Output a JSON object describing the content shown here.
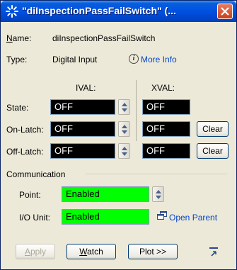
{
  "window": {
    "title": "\"diInspectionPassFailSwitch\" (..."
  },
  "info": {
    "name_label": "Name:",
    "name_value": "diInspectionPassFailSwitch",
    "type_label": "Type:",
    "type_value": "Digital Input",
    "more_info": "More Info"
  },
  "columns": {
    "ival": "IVAL:",
    "xval": "XVAL:"
  },
  "rows": [
    {
      "label": "State:",
      "ival": "OFF",
      "xval": "OFF",
      "clear": ""
    },
    {
      "label": "On-Latch:",
      "ival": "OFF",
      "xval": "OFF",
      "clear": "Clear"
    },
    {
      "label": "Off-Latch:",
      "ival": "OFF",
      "xval": "OFF",
      "clear": "Clear"
    }
  ],
  "communication": {
    "group_label": "Communication",
    "point_label": "Point:",
    "point_value": "Enabled",
    "io_label": "I/O Unit:",
    "io_value": "Enabled",
    "open_parent": "Open Parent",
    "enabled_color": "#00ff00"
  },
  "buttons": {
    "apply": "Apply",
    "watch": "Watch",
    "plot": "Plot >>"
  },
  "icons": {
    "title": "spinner-icon",
    "close": "close-icon",
    "info": "info-icon",
    "open_parent": "open-parent-icon",
    "collapse": "collapse-icon"
  }
}
